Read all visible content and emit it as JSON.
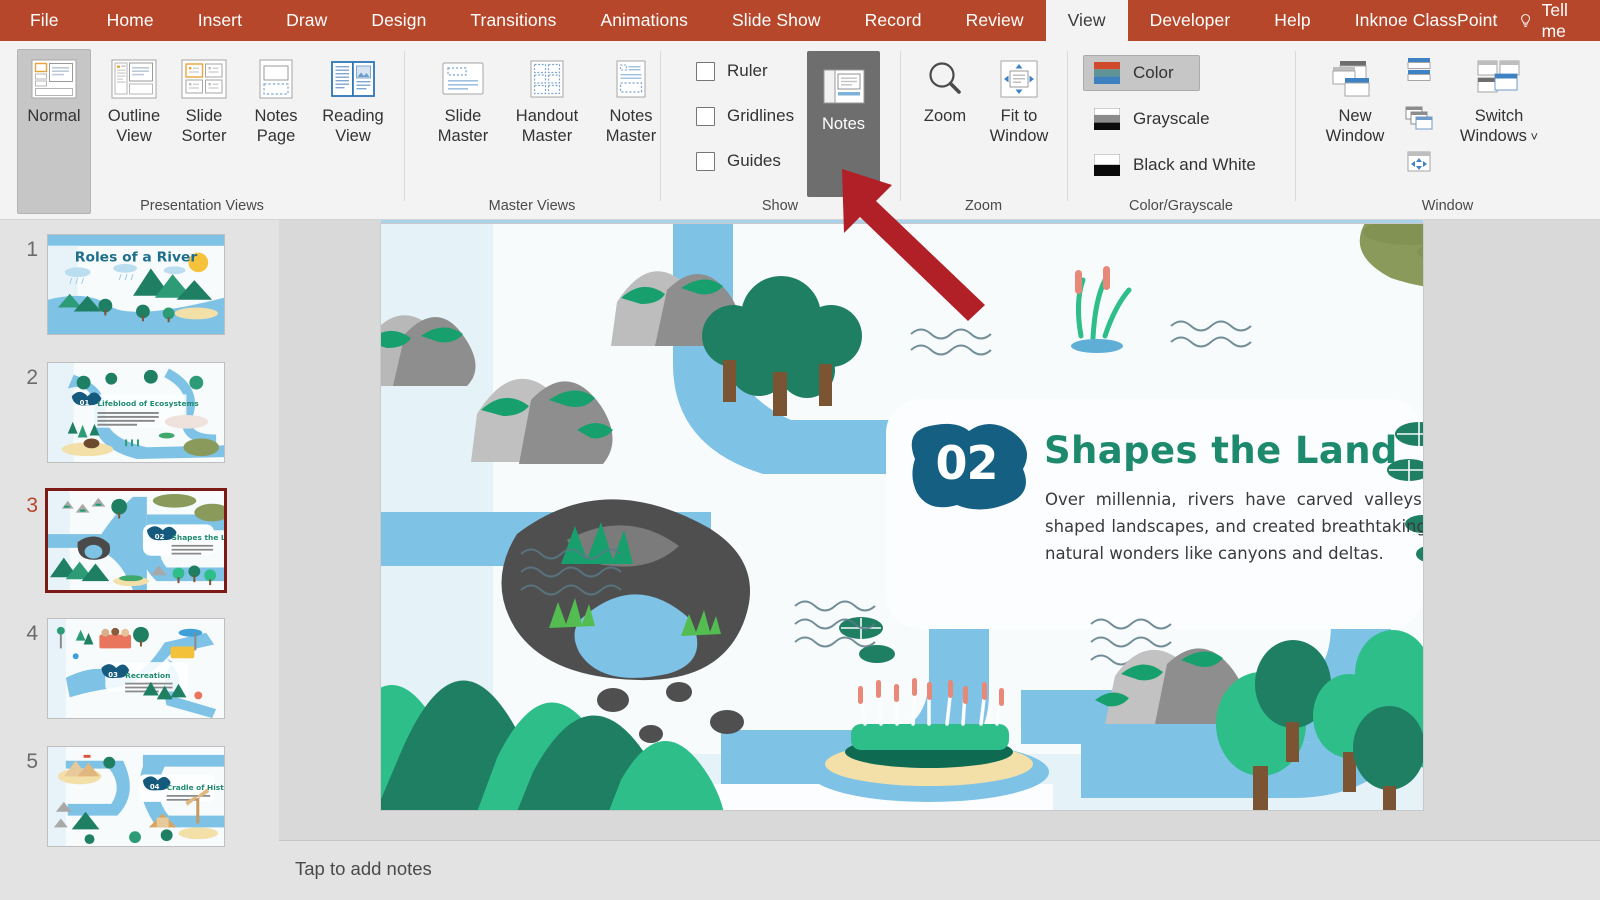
{
  "app": {
    "accent_ribbon": "#B7472A",
    "annotation_arrow_color": "#B11F27"
  },
  "tabs": [
    {
      "label": "File",
      "active": false
    },
    {
      "label": "Home",
      "active": false
    },
    {
      "label": "Insert",
      "active": false
    },
    {
      "label": "Draw",
      "active": false
    },
    {
      "label": "Design",
      "active": false
    },
    {
      "label": "Transitions",
      "active": false
    },
    {
      "label": "Animations",
      "active": false
    },
    {
      "label": "Slide Show",
      "active": false
    },
    {
      "label": "Record",
      "active": false
    },
    {
      "label": "Review",
      "active": false
    },
    {
      "label": "View",
      "active": true
    },
    {
      "label": "Developer",
      "active": false
    },
    {
      "label": "Help",
      "active": false
    },
    {
      "label": "Inknoe ClassPoint",
      "active": false
    }
  ],
  "tellme": {
    "label": "Tell me",
    "icon": "lightbulb-icon"
  },
  "ribbon": {
    "groups": [
      {
        "name": "Presentation Views",
        "label": "Presentation Views"
      },
      {
        "name": "Master Views",
        "label": "Master Views"
      },
      {
        "name": "Show",
        "label": "Show"
      },
      {
        "name": "Zoom",
        "label": "Zoom"
      },
      {
        "name": "Color/Grayscale",
        "label": "Color/Grayscale"
      },
      {
        "name": "Window",
        "label": "Window"
      }
    ],
    "presentation_views": [
      {
        "label": "Normal",
        "line1": "Normal",
        "line2": "",
        "selected": true
      },
      {
        "label": "Outline View",
        "line1": "Outline",
        "line2": "View",
        "selected": false
      },
      {
        "label": "Slide Sorter",
        "line1": "Slide",
        "line2": "Sorter",
        "selected": false
      },
      {
        "label": "Notes Page",
        "line1": "Notes",
        "line2": "Page",
        "selected": false
      },
      {
        "label": "Reading View",
        "line1": "Reading",
        "line2": "View",
        "selected": false
      }
    ],
    "master_views": [
      {
        "label": "Slide Master",
        "line1": "Slide",
        "line2": "Master"
      },
      {
        "label": "Handout Master",
        "line1": "Handout",
        "line2": "Master"
      },
      {
        "label": "Notes Master",
        "line1": "Notes",
        "line2": "Master"
      }
    ],
    "show": {
      "checkboxes": [
        {
          "label": "Ruler",
          "checked": false
        },
        {
          "label": "Gridlines",
          "checked": false
        },
        {
          "label": "Guides",
          "checked": false
        }
      ],
      "notes_button": {
        "label": "Notes",
        "selected": true
      }
    },
    "zoom": [
      {
        "label": "Zoom",
        "line1": "Zoom",
        "line2": ""
      },
      {
        "label": "Fit to Window",
        "line1": "Fit to",
        "line2": "Window"
      }
    ],
    "color_grayscale": [
      {
        "label": "Color",
        "selected": true
      },
      {
        "label": "Grayscale",
        "selected": false
      },
      {
        "label": "Black and White",
        "selected": false
      }
    ],
    "window": {
      "new_window": {
        "line1": "New",
        "line2": "Window"
      },
      "switch_windows": {
        "line1": "Switch",
        "line2": "Windows"
      },
      "arrange_all": "Arrange All",
      "cascade": "Cascade",
      "move_split": "Move Split"
    }
  },
  "thumbnails": [
    {
      "number": "1",
      "title": "Roles of a River",
      "current": false
    },
    {
      "number": "2",
      "title": "Lifeblood of Ecosystems",
      "badge": "01",
      "current": false
    },
    {
      "number": "3",
      "title": "Shapes the Land",
      "badge": "02",
      "current": true
    },
    {
      "number": "4",
      "title": "Recreation",
      "badge": "03",
      "current": false
    },
    {
      "number": "5",
      "title": "Cradle of History",
      "badge": "04",
      "current": false
    }
  ],
  "slide": {
    "badge": "02",
    "title": "Shapes the Land",
    "body": "Over millennia, rivers have carved valleys, shaped landscapes, and created breathtaking natural wonders like canyons and deltas.",
    "colors": {
      "title_green": "#1D8A6E",
      "badge_blue": "#155F83",
      "river_blue": "#6DB8E0",
      "background": "#F7FBFC"
    }
  },
  "notes": {
    "placeholder": "Tap to add notes"
  }
}
